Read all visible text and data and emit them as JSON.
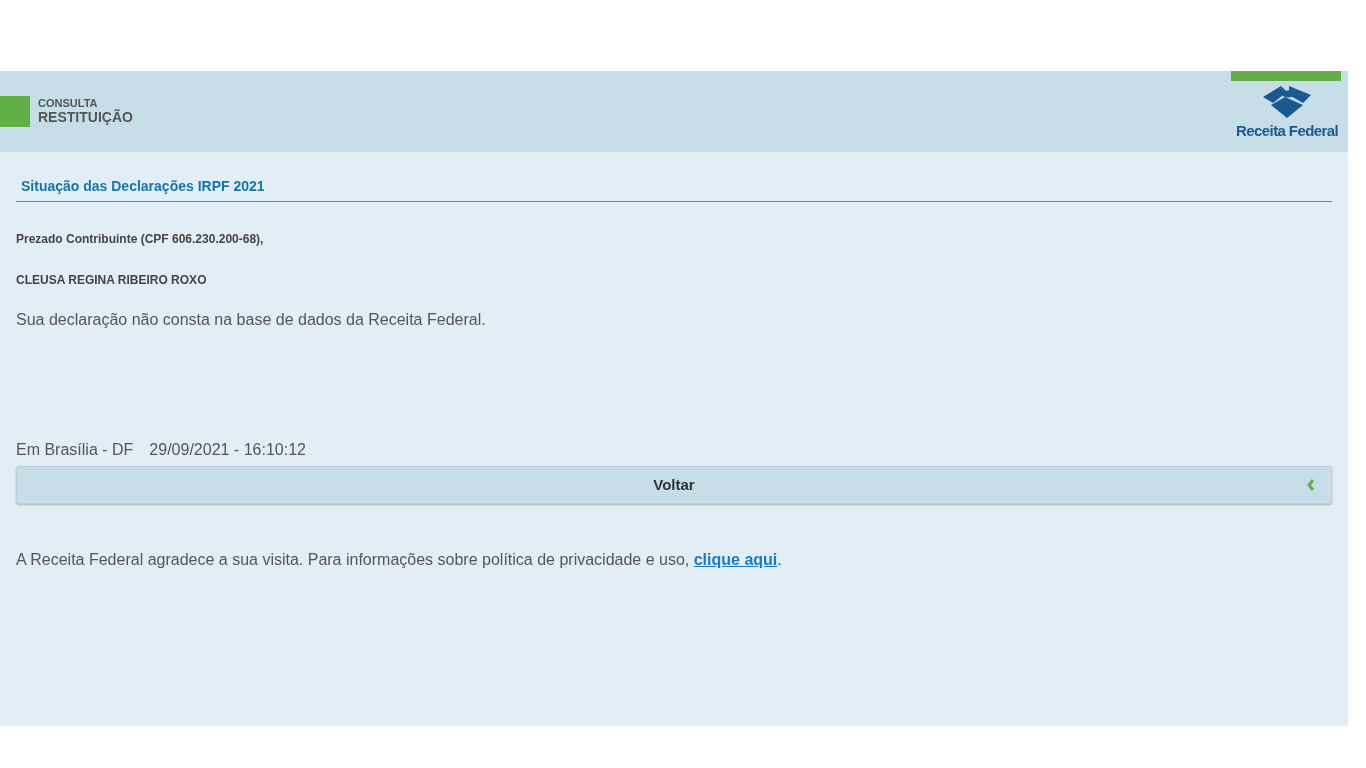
{
  "header": {
    "kicker": "CONSULTA",
    "title": "RESTITUIÇÃO",
    "logo_text": "Receita Federal"
  },
  "section_title": "Situação das Declarações IRPF 2021",
  "greeting": "Prezado Contribuinte (CPF 606.230.200-68),",
  "name": "CLEUSA REGINA RIBEIRO ROXO",
  "message": "Sua declaração não consta na base de dados da Receita Federal.",
  "place": "Em Brasília - DF",
  "timestamp": "29/09/2021 - 16:10:12",
  "back_button": "Voltar",
  "footer": {
    "text": "A Receita Federal agradece a sua visita. Para informações sobre política de privacidade e uso, ",
    "link": "clique aqui",
    "after": "."
  }
}
